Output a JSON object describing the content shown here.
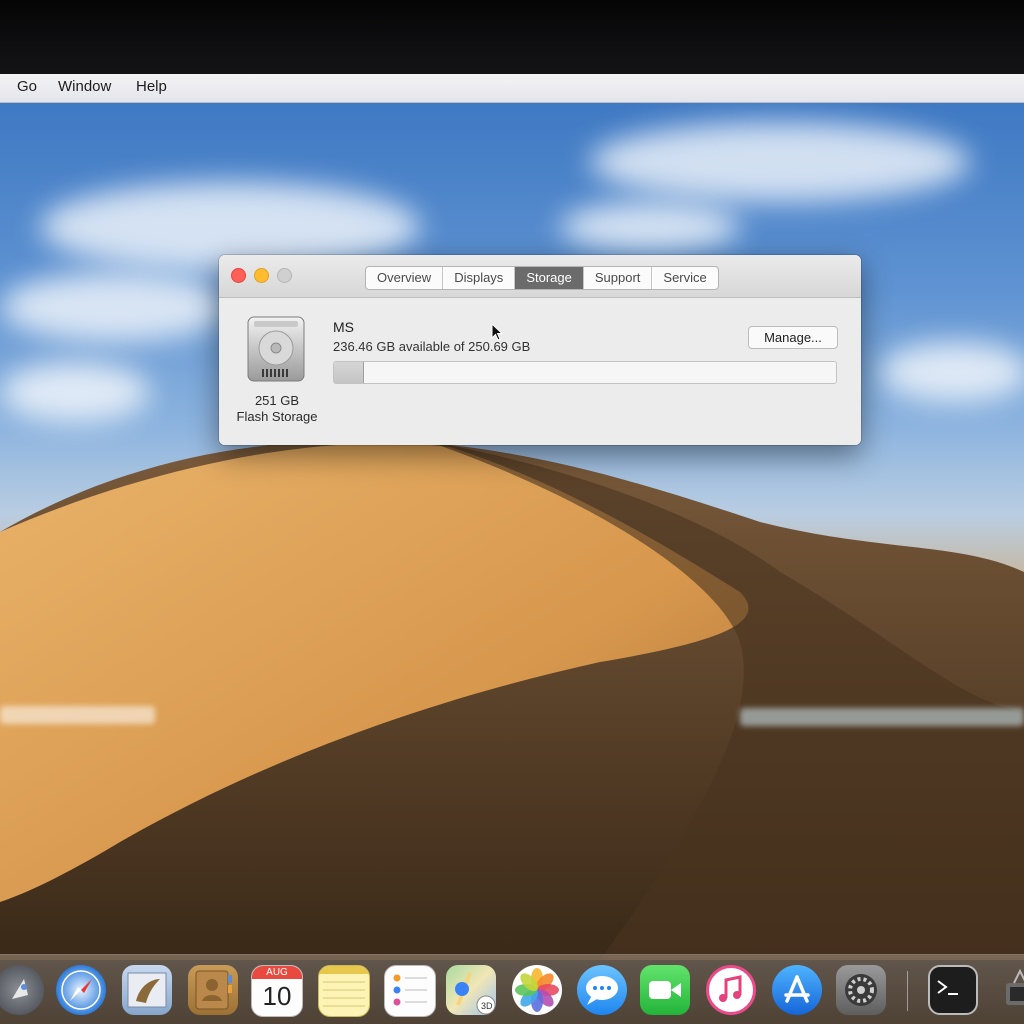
{
  "menubar": {
    "items": [
      "Go",
      "Window",
      "Help"
    ]
  },
  "window": {
    "tabs": [
      {
        "label": "Overview",
        "active": false
      },
      {
        "label": "Displays",
        "active": false
      },
      {
        "label": "Storage",
        "active": true
      },
      {
        "label": "Support",
        "active": false
      },
      {
        "label": "Service",
        "active": false
      }
    ],
    "drive": {
      "size": "251 GB",
      "type": "Flash Storage",
      "volume_name": "MS",
      "availability": "236.46 GB available of 250.69 GB",
      "used_fraction": 0.057
    },
    "manage_label": "Manage..."
  },
  "calendar": {
    "month": "AUG",
    "day": "10"
  },
  "dock": {
    "icons": [
      "launchpad-icon",
      "safari-icon",
      "mail-icon",
      "contacts-icon",
      "calendar-icon",
      "notes-icon",
      "reminders-icon",
      "maps-icon",
      "photos-icon",
      "messages-icon",
      "facetime-icon",
      "itunes-icon",
      "app-store-icon",
      "system-preferences-icon",
      "terminal-icon",
      "system-information-icon"
    ]
  },
  "colors": {
    "close": "#fe5f57",
    "minimize": "#febc2e",
    "active_tab": "#6b6b6b"
  }
}
